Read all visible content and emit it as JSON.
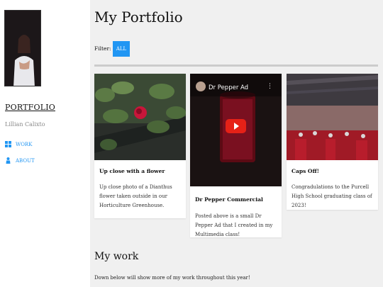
{
  "sidebar": {
    "site_title": "PORTFOLIO",
    "author": "Lillian Calixto",
    "nav": [
      {
        "label": "WORK",
        "icon": "grid-icon"
      },
      {
        "label": "ABOUT",
        "icon": "person-icon"
      }
    ]
  },
  "main": {
    "page_title": "My Portfolio",
    "filter_label": "Filter:",
    "filter_button": "ALL",
    "cards": [
      {
        "title": "Up close with a flower",
        "text": "Up close photo of a Dianthus flower taken outside in our Horticulture Greenhouse."
      },
      {
        "title": "Dr Pepper Commercial",
        "text": "Posted above is a small Dr Pepper Ad that I created in my Multimedia class!",
        "video_title": "Dr Pepper Ad"
      },
      {
        "title": "Caps Off!",
        "text": "Congradulations to the Purcell High School graduating class of 2023!"
      }
    ],
    "section_title": "My work",
    "section_text": "Down below will show more of my work throughout this year!"
  },
  "colors": {
    "accent": "#2196f3",
    "background": "#f0f0f0",
    "sidebar": "#ffffff",
    "youtube_red": "#e62117"
  }
}
